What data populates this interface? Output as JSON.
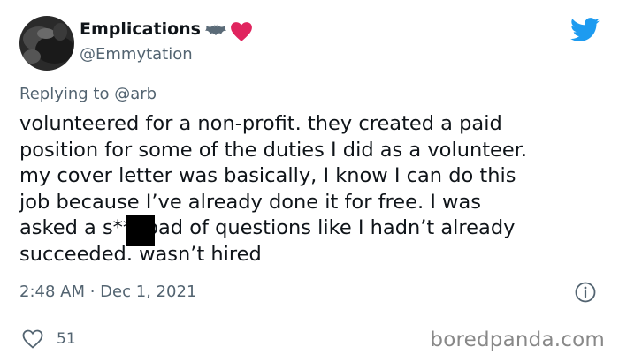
{
  "author": {
    "display_name": "Emplications",
    "handle": "@Emmytation",
    "avatar_icon": "avatar-photo",
    "badges": [
      "bat-icon",
      "red-heart-icon"
    ]
  },
  "header": {
    "platform_icon": "twitter-bird-icon",
    "brand_color": "#1d9bf0"
  },
  "reply": {
    "prefix": "Replying to",
    "handle": "@arb"
  },
  "tweet": {
    "text": "volunteered for a non-profit. they created a paid\nposition for some of the duties I did as a volunteer.\nmy cover letter was basically, I know I can do this\njob because I’ve already done it for free. I was\nasked a s**tload of questions like I hadn’t already\nsucceeded. wasn’t hired"
  },
  "meta": {
    "timestamp": "2:48 AM · Dec 1, 2021",
    "info_icon": "info-icon"
  },
  "engagement": {
    "like_icon": "heart-outline-icon",
    "like_count": "51"
  },
  "watermark": {
    "text": "boredpanda.com"
  }
}
